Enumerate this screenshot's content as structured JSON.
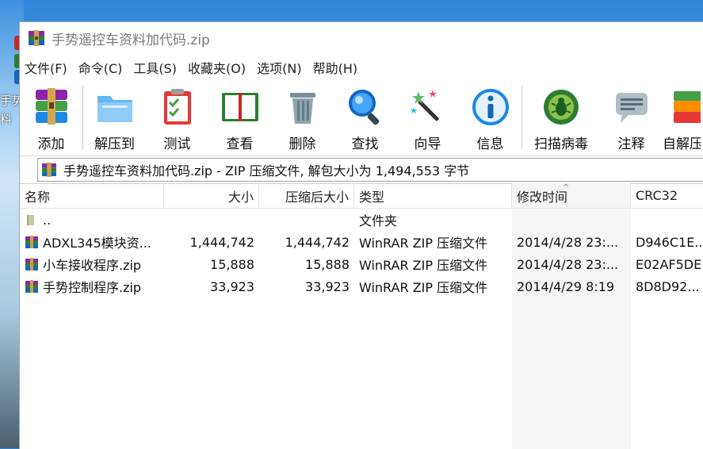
{
  "desktop": {
    "icon_text_1": "手势",
    "icon_text_2": "料"
  },
  "window": {
    "title": "手势遥控车资料加代码.zip"
  },
  "menu": [
    "文件(F)",
    "命令(C)",
    "工具(S)",
    "收藏夹(O)",
    "选项(N)",
    "帮助(H)"
  ],
  "toolbar": {
    "add": "添加",
    "extract": "解压到",
    "test": "测试",
    "view": "查看",
    "delete": "删除",
    "find": "查找",
    "wizard": "向导",
    "info": "信息",
    "scan": "扫描病毒",
    "comment": "注释",
    "sfx": "自解压"
  },
  "address": {
    "text": "手势遥控车资料加代码.zip - ZIP 压缩文件, 解包大小为 1,494,553 字节"
  },
  "columns": {
    "name": "名称",
    "size": "大小",
    "packed": "压缩后大小",
    "type": "类型",
    "modified": "修改时间",
    "crc": "CRC32"
  },
  "rows": [
    {
      "name": "..",
      "size": "",
      "packed": "",
      "type": "文件夹",
      "modified": "",
      "crc": "",
      "icon": "folder-icon"
    },
    {
      "name": "ADXL345模块资...",
      "size": "1,444,742",
      "packed": "1,444,742",
      "type": "WinRAR ZIP 压缩文件",
      "modified": "2014/4/28 23:...",
      "crc": "D946C1E...",
      "icon": "winrar-archive-icon"
    },
    {
      "name": "小车接收程序.zip",
      "size": "15,888",
      "packed": "15,888",
      "type": "WinRAR ZIP 压缩文件",
      "modified": "2014/4/28 23:...",
      "crc": "E02AF5DE",
      "icon": "winrar-archive-icon"
    },
    {
      "name": "手势控制程序.zip",
      "size": "33,923",
      "packed": "33,923",
      "type": "WinRAR ZIP 压缩文件",
      "modified": "2014/4/29 8:19",
      "crc": "8D8D92...",
      "icon": "winrar-archive-icon"
    }
  ],
  "colors": {
    "accent": "#1e7bd6",
    "sorted_column_bg": "#f5f5f5"
  }
}
